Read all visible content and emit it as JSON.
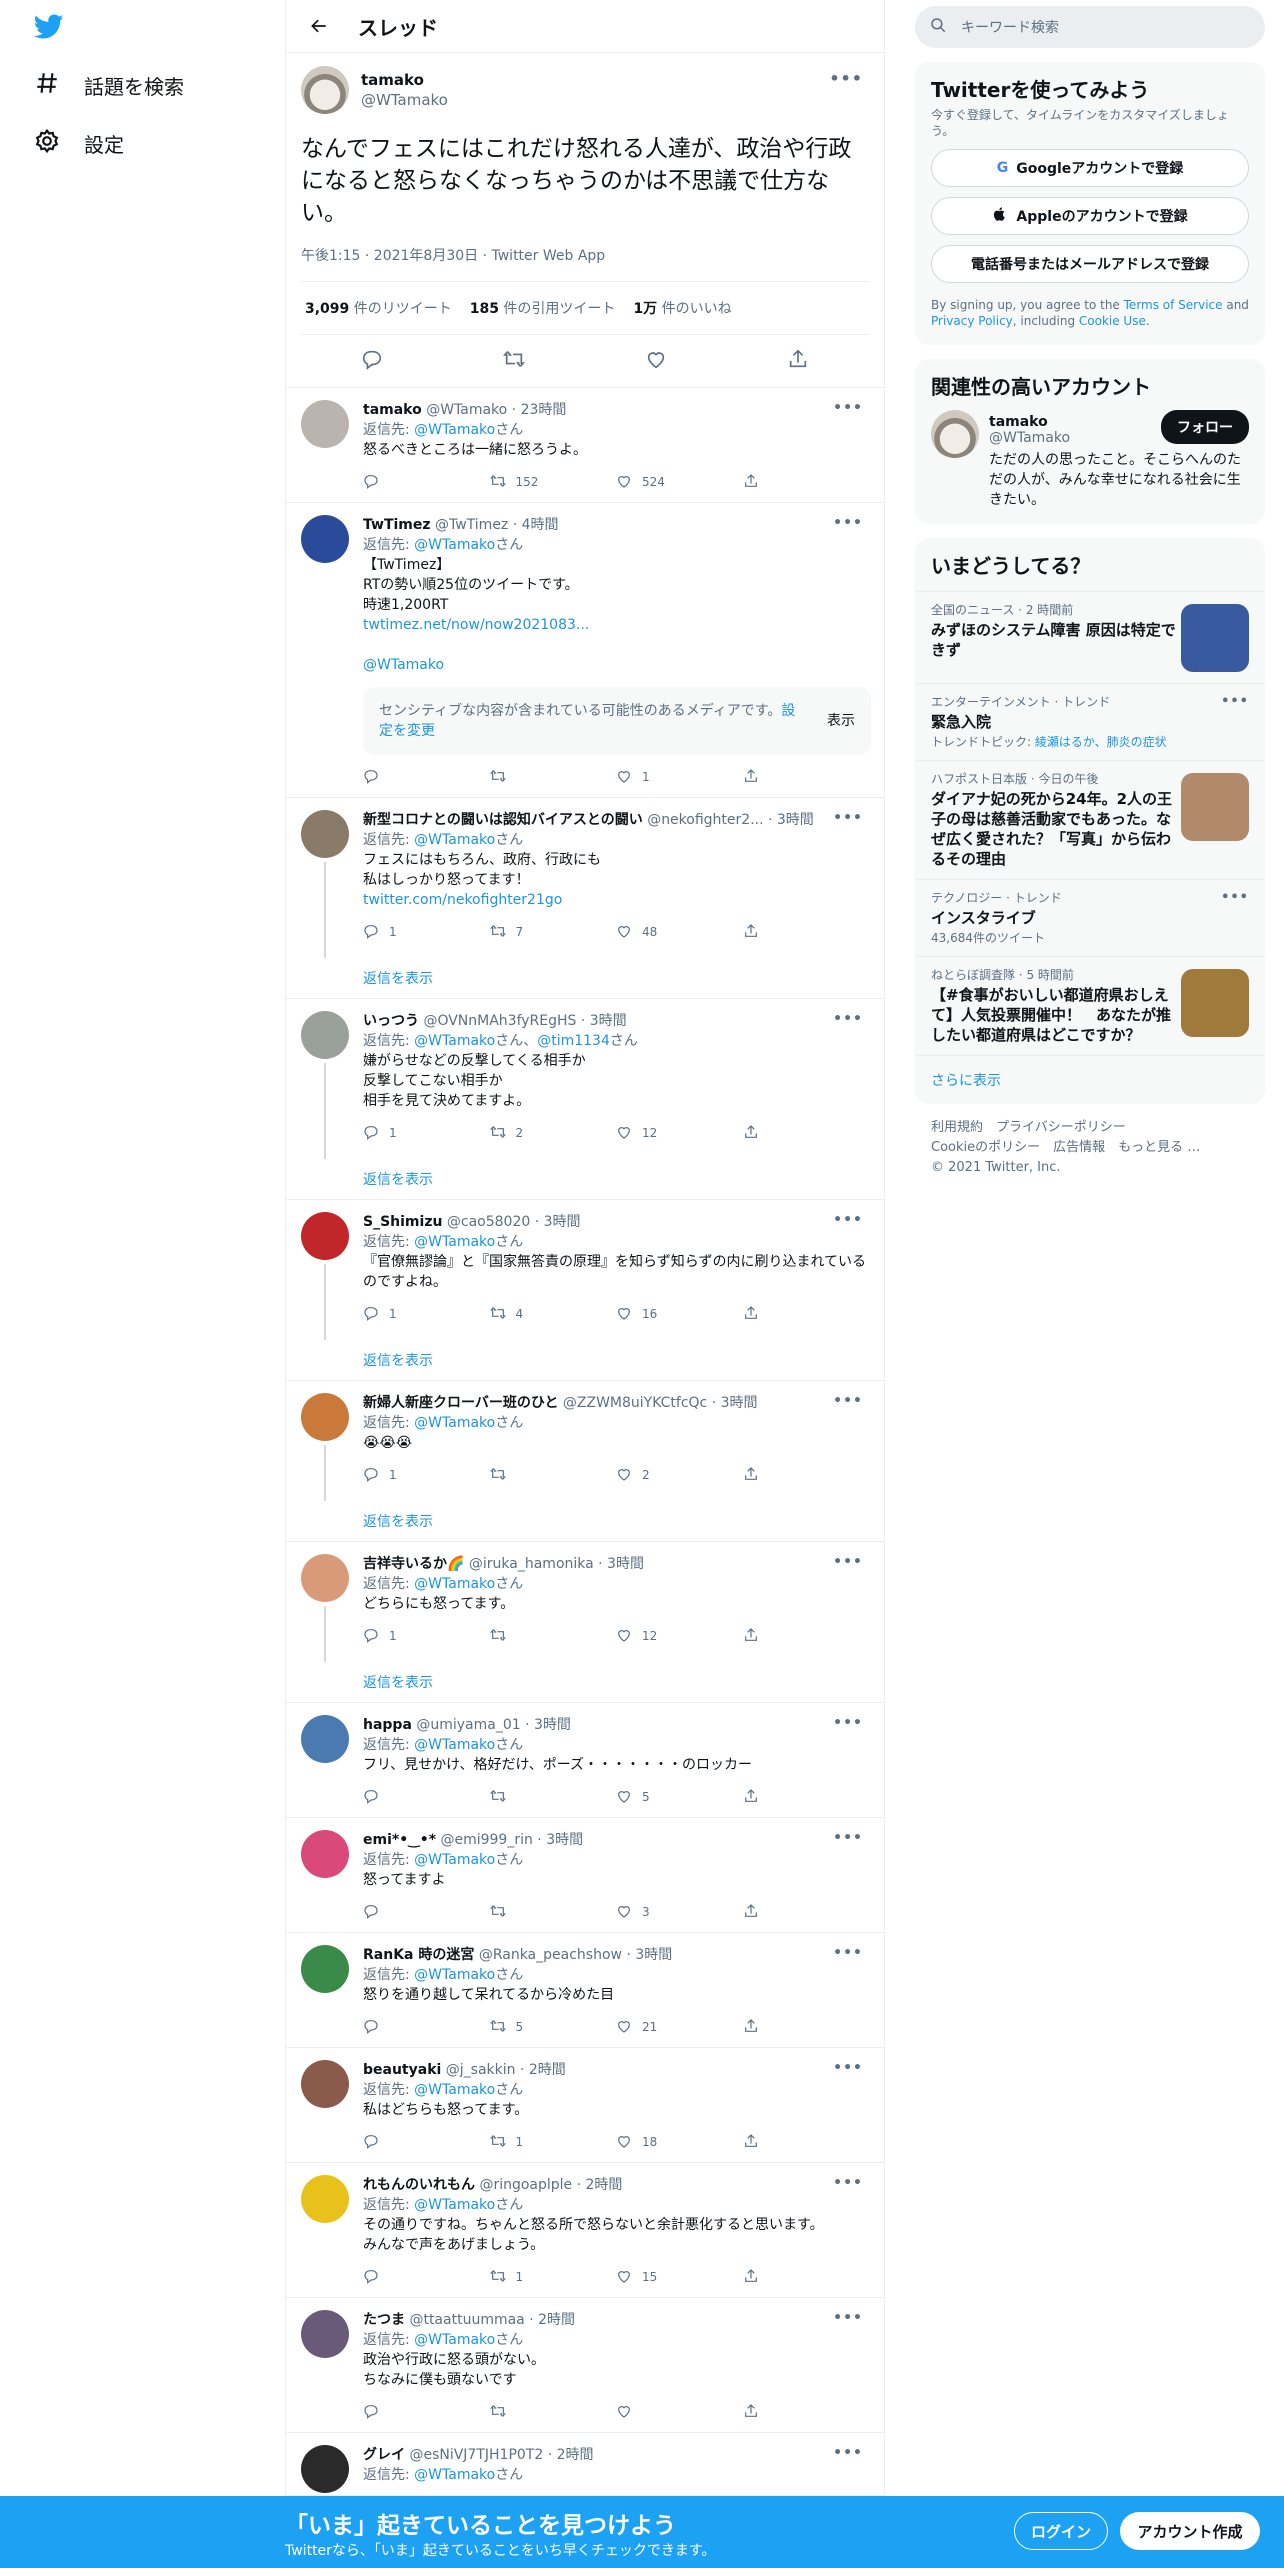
{
  "nav": {
    "items": [
      {
        "label": "話題を検索",
        "icon": "hashtag-icon"
      },
      {
        "label": "設定",
        "icon": "gear-icon"
      }
    ]
  },
  "header": {
    "title": "スレッド"
  },
  "main_tweet": {
    "name": "tamako",
    "handle": "@WTamako",
    "text": "なんでフェスにはこれだけ怒れる人達が、政治や行政になると怒らなくなっちゃうのかは不思議で仕方ない。",
    "meta": "午後1:15 · 2021年8月30日 · Twitter Web App",
    "retweets_count": "3,099",
    "retweets_label": " 件のリツイート",
    "quotes_count": "185",
    "quotes_label": " 件の引用ツイート",
    "likes_count": "1万",
    "likes_label": " 件のいいね"
  },
  "reply_to_label": "返信先: ",
  "reply_to_suffix": "さん",
  "show_replies_label": "返信を表示",
  "sensitive": {
    "text": "センシティブな内容が含まれている可能性のあるメディアです。",
    "link": "設定を変更",
    "button": "表示"
  },
  "replies": [
    {
      "name": "tamako",
      "handle": "@WTamako · 23時間",
      "to": "@WTamako",
      "text": "怒るべきところは一緒に怒ろうよ。",
      "reply": "",
      "rt": "152",
      "like": "524",
      "avatar": "#b9b4ad",
      "thread": false
    },
    {
      "name": "TwTimez",
      "handle": "@TwTimez · 4時間",
      "to": "@WTamako",
      "text": "【TwTimez】\nRTの勢い順25位のツイートです。\n時速1,200RT",
      "link1": "twtimez.net/now/now2021083...",
      "link2": "@WTamako",
      "reply": "",
      "rt": "",
      "like": "1",
      "avatar": "#2a4a9a",
      "thread": false,
      "sensitive": true
    },
    {
      "name": "新型コロナとの闘いは認知バイアスとの闘い",
      "handle": "@nekofighter2... · 3時間",
      "to": "@WTamako",
      "text": "フェスにはもちろん、政府、行政にも\n私はしっかり怒ってます！",
      "link1": "twitter.com/nekofighter21go",
      "reply": "1",
      "rt": "7",
      "like": "48",
      "avatar": "#8a7a6a",
      "thread": true
    },
    {
      "name": "いっつう",
      "handle": "@OVNnMAh3fyREgHS · 3時間",
      "to": "@WTamako",
      "to2": "@tim1134",
      "text": "嫌がらせなどの反撃してくる相手か\n反撃してこない相手か\n相手を見て決めてますよ。",
      "reply": "1",
      "rt": "2",
      "like": "12",
      "avatar": "#9aa09a",
      "thread": true
    },
    {
      "name": "S_Shimizu",
      "handle": "@cao58020 · 3時間",
      "to": "@WTamako",
      "text": "『官僚無謬論』と『国家無答責の原理』を知らず知らずの内に刷り込まれているのですよね。",
      "reply": "1",
      "rt": "4",
      "like": "16",
      "avatar": "#c0262a",
      "thread": true
    },
    {
      "name": "新婦人新座クローバー班のひと",
      "handle": "@ZZWM8uiYKCtfcQc · 3時間",
      "to": "@WTamako",
      "text": "😭😭😭",
      "reply": "1",
      "rt": "",
      "like": "2",
      "avatar": "#c97a3a",
      "thread": true
    },
    {
      "name": "吉祥寺いるか🌈",
      "handle": "@iruka_hamonika · 3時間",
      "to": "@WTamako",
      "text": "どちらにも怒ってます。",
      "reply": "1",
      "rt": "",
      "like": "12",
      "avatar": "#d99a7a",
      "thread": true
    },
    {
      "name": "happa",
      "handle": "@umiyama_01 · 3時間",
      "to": "@WTamako",
      "text": "フリ、見せかけ、格好だけ、ポーズ・・・・・・・のロッカー",
      "reply": "",
      "rt": "",
      "like": "5",
      "avatar": "#4a7ab0",
      "thread": false
    },
    {
      "name": "emi*•‿•*",
      "handle": "@emi999_rin · 3時間",
      "to": "@WTamako",
      "text": "怒ってますよ",
      "reply": "",
      "rt": "",
      "like": "3",
      "avatar": "#d94a7a",
      "thread": false
    },
    {
      "name": "RanKa 時の迷宮",
      "handle": "@Ranka_peachshow · 3時間",
      "to": "@WTamako",
      "text": "怒りを通り越して呆れてるから冷めた目",
      "reply": "",
      "rt": "5",
      "like": "21",
      "avatar": "#3a8a4a",
      "thread": false
    },
    {
      "name": "beautyaki",
      "handle": "@j_sakkin · 2時間",
      "to": "@WTamako",
      "text": "私はどちらも怒ってます。",
      "reply": "",
      "rt": "1",
      "like": "18",
      "avatar": "#8a5a4a",
      "thread": false
    },
    {
      "name": "れもんのいれもん",
      "handle": "@ringoaplple · 2時間",
      "to": "@WTamako",
      "text": "その通りですね。ちゃんと怒る所で怒らないと余計悪化すると思います。\nみんなで声をあげましょう。",
      "reply": "",
      "rt": "1",
      "like": "15",
      "avatar": "#e8c21a",
      "thread": false
    },
    {
      "name": "たつま",
      "handle": "@ttaattuummaa · 2時間",
      "to": "@WTamako",
      "text": "政治や行政に怒る頭がない。\nちなみに僕も頭ないです",
      "reply": "",
      "rt": "",
      "like": "",
      "avatar": "#6a5a7a",
      "thread": false
    },
    {
      "name": "グレイ",
      "handle": "@esNiVJ7TJH1P0T2 · 2時間",
      "to": "@WTamako",
      "text": "",
      "reply": "",
      "rt": "",
      "like": "",
      "avatar": "#2a2a2a",
      "thread": false
    }
  ],
  "search": {
    "placeholder": "キーワード検索"
  },
  "signup": {
    "title": "Twitterを使ってみよう",
    "sub": "今すぐ登録して、タイムラインをカスタマイズしましょう。",
    "google": "Googleアカウントで登録",
    "apple": "Appleのアカウントで登録",
    "phone": "電話番号またはメールアドレスで登録",
    "terms_prefix": "By signing up, you agree to the ",
    "terms_link": "Terms of Service",
    "terms_and": " and ",
    "privacy_link": "Privacy Policy",
    "terms_including": ", including ",
    "cookie_link": "Cookie Use",
    "terms_end": "."
  },
  "related": {
    "title": "関連性の高いアカウント",
    "name": "tamako",
    "handle": "@WTamako",
    "bio": "ただの人の思ったこと。そこらへんのただの人が、みんな幸せになれる社会に生きたい。",
    "follow": "フォロー"
  },
  "trends": {
    "title": "いまどうしてる？",
    "items": [
      {
        "meta": "全国のニュース · 2 時間前",
        "title": "みずほのシステム障害 原因は特定できず",
        "sub": "",
        "thumb": "#3a5aa0",
        "dots": false
      },
      {
        "meta": "エンターテインメント · トレンド",
        "title": "緊急入院",
        "sub_prefix": "トレンドトピック: ",
        "sub_link": "綾瀬はるか、肺炎の症状",
        "thumb": "",
        "dots": true
      },
      {
        "meta": "ハフポスト日本版 · 今日の午後",
        "title": "ダイアナ妃の死から24年。2人の王子の母は慈善活動家でもあった。なぜ広く愛された？「写真」から伝わるその理由",
        "sub": "",
        "thumb": "#b08a6a",
        "dots": false
      },
      {
        "meta": "テクノロジー · トレンド",
        "title": "インスタライブ",
        "sub": "43,684件のツイート",
        "thumb": "",
        "dots": true
      },
      {
        "meta": "ねとらぼ調査隊 · 5 時間前",
        "title": "【#食事がおいしい都道府県おしえて】人気投票開催中！　あなたが推したい都道府県はどこですか？",
        "sub": "",
        "thumb": "#a07a3a",
        "dots": false
      }
    ],
    "more": "さらに表示"
  },
  "footer": {
    "line1": "利用規約　プライバシーポリシー",
    "line2": "Cookieのポリシー　広告情報　もっと見る …",
    "line3": "© 2021 Twitter, Inc."
  },
  "bottom": {
    "title": "「いま」起きていることを見つけよう",
    "sub": "Twitterなら、「いま」起きていることをいち早くチェックできます。",
    "login": "ログイン",
    "signup": "アカウント作成"
  },
  "colors": {
    "accent": "#1da1f2",
    "link": "#1b95e0"
  }
}
